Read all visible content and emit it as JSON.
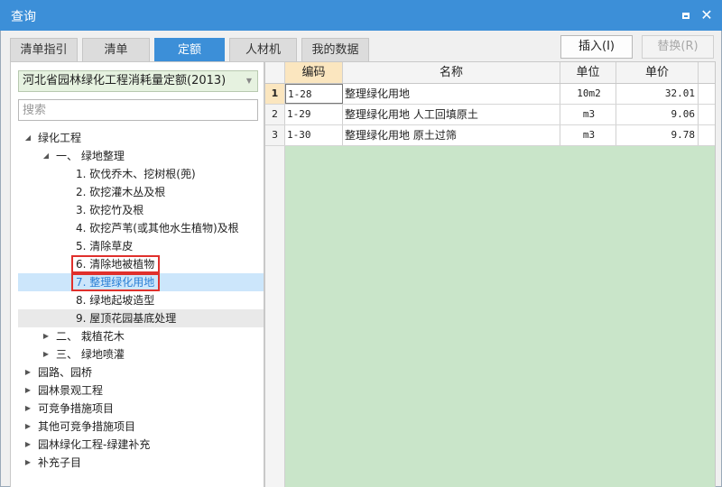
{
  "window": {
    "title": "查询",
    "maximize_icon": "maximize-icon",
    "close_icon": "close-icon",
    "accent_color": "#3c8fd8"
  },
  "tabs": [
    {
      "label": "清单指引",
      "active": false
    },
    {
      "label": "清单",
      "active": false
    },
    {
      "label": "定额",
      "active": true
    },
    {
      "label": "人材机",
      "active": false
    },
    {
      "label": "我的数据",
      "active": false
    }
  ],
  "actions": {
    "insert_label": "插入(I)",
    "replace_label": "替换(R)"
  },
  "library": {
    "selected": "河北省园林绿化工程消耗量定额(2013)"
  },
  "search": {
    "placeholder": "搜索",
    "value": ""
  },
  "tree": [
    {
      "label": "绿化工程",
      "toggle": "◢"
    },
    {
      "label": "一、 绿地整理",
      "toggle": "◢"
    },
    {
      "label": "1. 砍伐乔木、挖树根(蔸)",
      "toggle": ""
    },
    {
      "label": "2. 砍挖灌木丛及根",
      "toggle": ""
    },
    {
      "label": "3. 砍挖竹及根",
      "toggle": ""
    },
    {
      "label": "4. 砍挖芦苇(或其他水生植物)及根",
      "toggle": ""
    },
    {
      "label": "5. 清除草皮",
      "toggle": ""
    },
    {
      "label": "6. 清除地被植物",
      "toggle": ""
    },
    {
      "label": "7. 整理绿化用地",
      "toggle": ""
    },
    {
      "label": "8. 绿地起坡造型",
      "toggle": ""
    },
    {
      "label": "9. 屋顶花园基底处理",
      "toggle": ""
    },
    {
      "label": "二、 栽植花木",
      "toggle": "▶"
    },
    {
      "label": "三、 绿地喷灌",
      "toggle": "▶"
    },
    {
      "label": "园路、园桥",
      "toggle": "▶"
    },
    {
      "label": "园林景观工程",
      "toggle": "▶"
    },
    {
      "label": "可竞争措施项目",
      "toggle": "▶"
    },
    {
      "label": "其他可竞争措施项目",
      "toggle": "▶"
    },
    {
      "label": "园林绿化工程-绿建补充",
      "toggle": "▶"
    },
    {
      "label": "补充子目",
      "toggle": "▶"
    }
  ],
  "table": {
    "headers": {
      "code": "编码",
      "name": "名称",
      "unit": "单位",
      "price": "单价"
    },
    "rows": [
      {
        "num": "1",
        "code": "1-28",
        "name": "整理绿化用地",
        "unit": "10m2",
        "price": "32.01"
      },
      {
        "num": "2",
        "code": "1-29",
        "name": "整理绿化用地 人工回填原土",
        "unit": "m3",
        "price": "9.06"
      },
      {
        "num": "3",
        "code": "1-30",
        "name": "整理绿化用地 原土过筛",
        "unit": "m3",
        "price": "9.78"
      }
    ]
  }
}
